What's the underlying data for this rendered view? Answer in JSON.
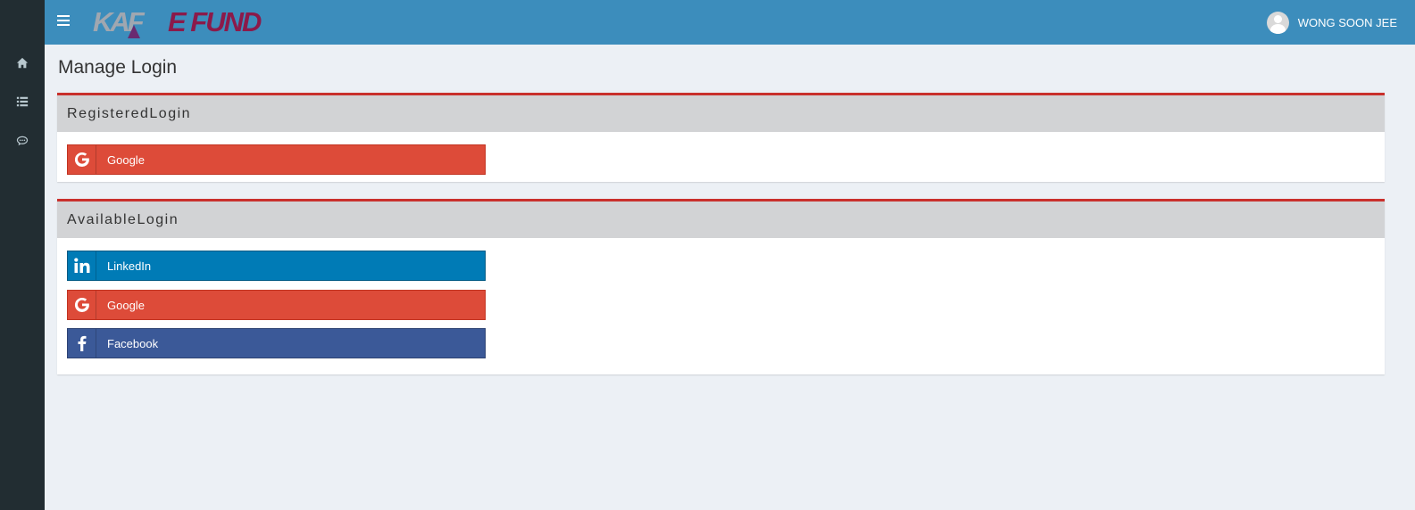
{
  "header": {
    "logo_text": "KAF E FUND",
    "username": "WONG SOON JEE"
  },
  "sidebar": {
    "items": [
      {
        "icon": "home-icon"
      },
      {
        "icon": "list-icon"
      },
      {
        "icon": "chat-icon"
      }
    ]
  },
  "page": {
    "title": "Manage Login"
  },
  "registered": {
    "title_first": "R",
    "title_rest": "egistered ",
    "title_second": "L",
    "title_rest2": "ogin",
    "buttons": [
      {
        "label": "Google",
        "icon": "google-icon"
      }
    ]
  },
  "available": {
    "title_first": "A",
    "title_rest": "vailable ",
    "title_second": "L",
    "title_rest2": "ogin",
    "buttons": [
      {
        "label": "LinkedIn",
        "icon": "linkedin-icon"
      },
      {
        "label": "Google",
        "icon": "google-icon"
      },
      {
        "label": "Facebook",
        "icon": "facebook-icon"
      }
    ]
  },
  "colors": {
    "header": "#3c8dbc",
    "sidebar": "#222d32",
    "accent": "#c9302c",
    "google": "#dd4b39",
    "linkedin": "#007bb6",
    "facebook": "#3b5998"
  }
}
